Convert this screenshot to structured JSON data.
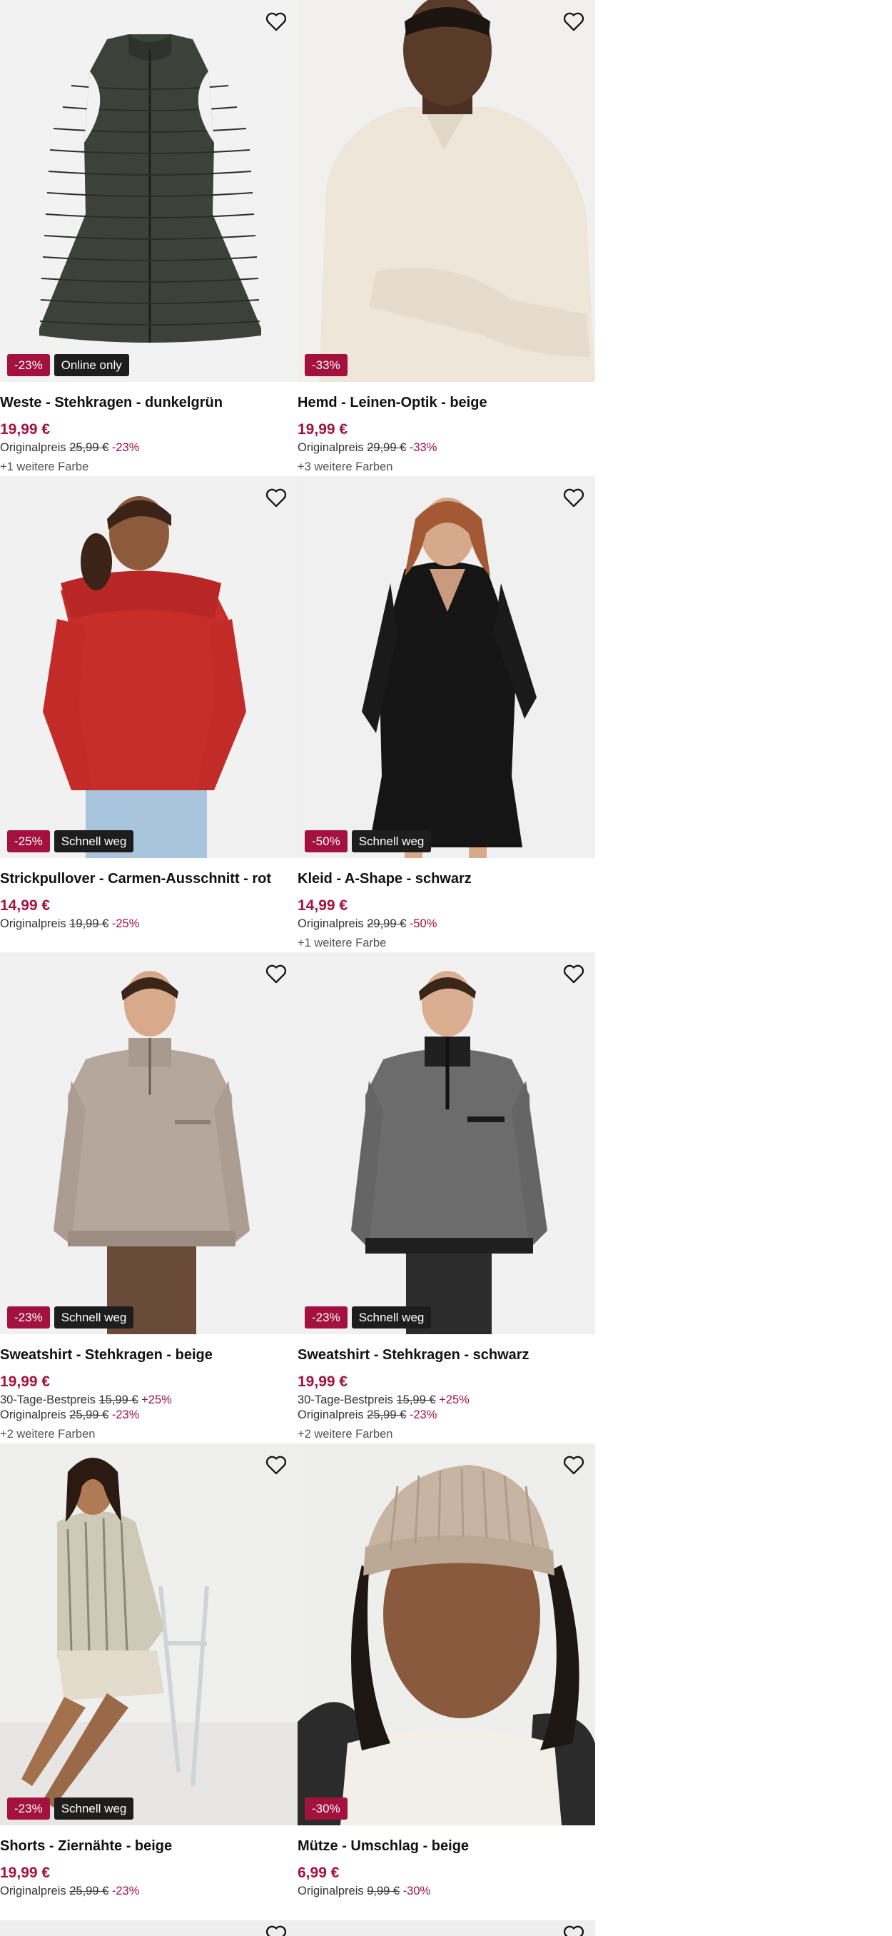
{
  "products": [
    {
      "name": "Weste - Stehkragen - dunkelgrün",
      "price": "19,99 €",
      "best_label": "",
      "best_price": "",
      "best_pct": "",
      "orig_label": "Originalpreis",
      "orig_price": "25,99 €",
      "orig_pct": "-23%",
      "colors": "+1 weitere Farbe",
      "badge_discount": "-23%",
      "badge_tag": "Online only",
      "image": "olive-puffer-vest"
    },
    {
      "name": "Hemd - Leinen-Optik - beige",
      "price": "19,99 €",
      "best_label": "",
      "best_price": "",
      "best_pct": "",
      "orig_label": "Originalpreis",
      "orig_price": "29,99 €",
      "orig_pct": "-33%",
      "colors": "+3 weitere Farben",
      "badge_discount": "-33%",
      "badge_tag": "",
      "image": "man-beige-shirt"
    },
    {
      "name": "Strickpullover - Carmen-Ausschnitt - rot",
      "price": "14,99 €",
      "best_label": "",
      "best_price": "",
      "best_pct": "",
      "orig_label": "Originalpreis",
      "orig_price": "19,99 €",
      "orig_pct": "-25%",
      "colors": "",
      "badge_discount": "-25%",
      "badge_tag": "Schnell weg",
      "image": "woman-red-sweater"
    },
    {
      "name": "Kleid - A-Shape - schwarz",
      "price": "14,99 €",
      "best_label": "",
      "best_price": "",
      "best_pct": "",
      "orig_label": "Originalpreis",
      "orig_price": "29,99 €",
      "orig_pct": "-50%",
      "colors": "+1 weitere Farbe",
      "badge_discount": "-50%",
      "badge_tag": "Schnell weg",
      "image": "woman-black-dress"
    },
    {
      "name": "Sweatshirt - Stehkragen - beige",
      "price": "19,99 €",
      "best_label": "30-Tage-Bestpreis",
      "best_price": "15,99 €",
      "best_pct": "+25%",
      "orig_label": "Originalpreis",
      "orig_price": "25,99 €",
      "orig_pct": "-23%",
      "colors": "+2 weitere Farben",
      "badge_discount": "-23%",
      "badge_tag": "Schnell weg",
      "image": "man-beige-sweatshirt"
    },
    {
      "name": "Sweatshirt - Stehkragen - schwarz",
      "price": "19,99 €",
      "best_label": "30-Tage-Bestpreis",
      "best_price": "15,99 €",
      "best_pct": "+25%",
      "orig_label": "Originalpreis",
      "orig_price": "25,99 €",
      "orig_pct": "-23%",
      "colors": "+2 weitere Farben",
      "badge_discount": "-23%",
      "badge_tag": "Schnell weg",
      "image": "man-grey-sweatshirt"
    },
    {
      "name": "Shorts - Ziernähte - beige",
      "price": "19,99 €",
      "best_label": "",
      "best_price": "",
      "best_pct": "",
      "orig_label": "Originalpreis",
      "orig_price": "25,99 €",
      "orig_pct": "-23%",
      "colors": "",
      "badge_discount": "-23%",
      "badge_tag": "Schnell weg",
      "image": "woman-beige-shorts"
    },
    {
      "name": "Mütze - Umschlag - beige",
      "price": "6,99 €",
      "best_label": "",
      "best_price": "",
      "best_pct": "",
      "orig_label": "Originalpreis",
      "orig_price": "9,99 €",
      "orig_pct": "-30%",
      "colors": "",
      "badge_discount": "-30%",
      "badge_tag": "",
      "image": "woman-beige-beanie"
    }
  ],
  "colors": {
    "accent": "#a3123f",
    "tag_bg": "#1d1d1d",
    "image_bg": "#eeeeee"
  }
}
